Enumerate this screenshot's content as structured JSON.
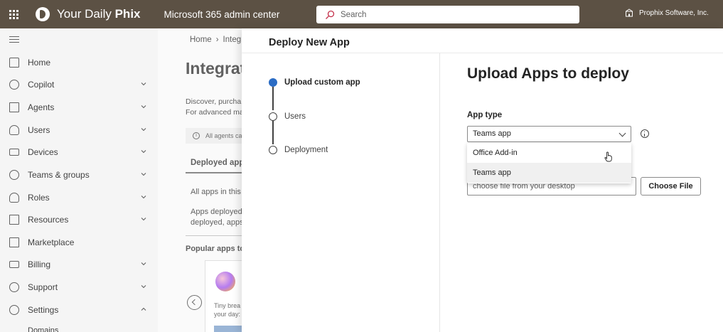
{
  "topbar": {
    "brand_prefix": "Your Daily ",
    "brand_bold": "Phix",
    "app_title": "Microsoft 365 admin center",
    "search_placeholder": "Search",
    "tenant": "Prophix Software, Inc."
  },
  "sidebar": {
    "items": [
      {
        "label": "Home",
        "icon": "home-icon"
      },
      {
        "label": "Copilot",
        "icon": "copilot-icon"
      },
      {
        "label": "Agents",
        "icon": "agents-icon"
      },
      {
        "label": "Users",
        "icon": "user-icon"
      },
      {
        "label": "Devices",
        "icon": "devices-icon"
      },
      {
        "label": "Teams & groups",
        "icon": "teams-icon"
      },
      {
        "label": "Roles",
        "icon": "roles-icon"
      },
      {
        "label": "Resources",
        "icon": "resources-icon"
      },
      {
        "label": "Marketplace",
        "icon": "marketplace-icon"
      },
      {
        "label": "Billing",
        "icon": "billing-icon"
      },
      {
        "label": "Support",
        "icon": "support-icon"
      },
      {
        "label": "Settings",
        "icon": "gear-icon"
      },
      {
        "label": "Domains",
        "icon": ""
      }
    ]
  },
  "main": {
    "crumb_home": "Home",
    "crumb_current": "Integ",
    "heading": "Integrat",
    "desc_line1": "Discover, purcha",
    "desc_line2": "For advanced ma",
    "info_text": "All agents ca",
    "tab_deployed": "Deployed apps",
    "all_apps": "All apps in this",
    "apps_deployed_line1": "Apps deployed",
    "apps_deployed_line2": "deployed, apps",
    "popular": "Popular apps to",
    "card_line1": "Tiny brea",
    "card_line2": "your day:"
  },
  "panel": {
    "title": "Deploy New App",
    "steps": [
      {
        "label": "Upload custom app",
        "active": true
      },
      {
        "label": "Users",
        "active": false
      },
      {
        "label": "Deployment",
        "active": false
      }
    ],
    "form_title": "Upload Apps to deploy",
    "app_type_label": "App type",
    "app_type_value": "Teams app",
    "dropdown_options": [
      "Office Add-in",
      "Teams app"
    ],
    "file_placeholder": "choose file from your desktop",
    "choose_file_label": "Choose File"
  },
  "colors": {
    "topbar_bg": "#5c5144",
    "active_step": "#2b6cc4"
  }
}
